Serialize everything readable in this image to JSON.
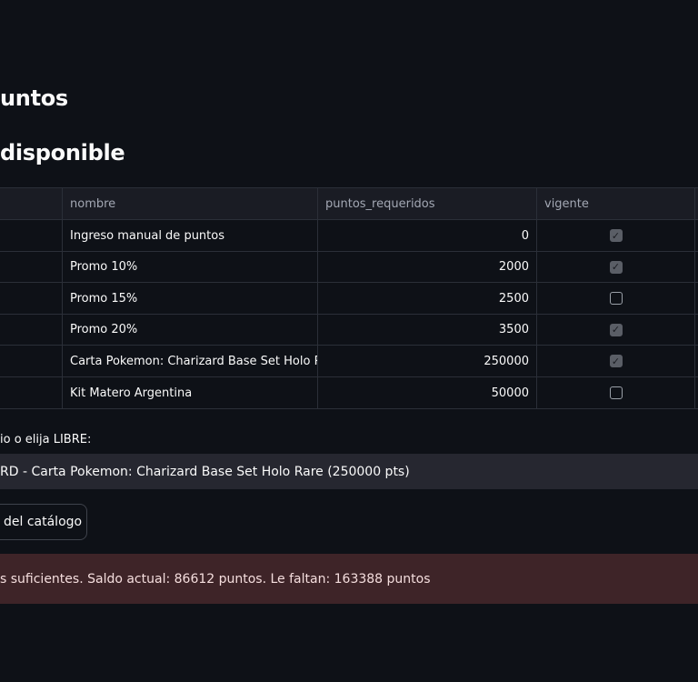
{
  "page": {
    "heading_partial": "untos",
    "subheading_partial": "disponible"
  },
  "table": {
    "columns": [
      "",
      "nombre",
      "puntos_requeridos",
      "vigente"
    ],
    "rows": [
      {
        "nombre": "Ingreso manual de puntos",
        "puntos_requeridos": "0",
        "vigente": true
      },
      {
        "nombre": "Promo 10%",
        "puntos_requeridos": "2000",
        "vigente": true
      },
      {
        "nombre": "Promo 15%",
        "puntos_requeridos": "2500",
        "vigente": false
      },
      {
        "nombre": "Promo 20%",
        "puntos_requeridos": "3500",
        "vigente": true
      },
      {
        "nombre": "Carta Pokemon: Charizard Base Set Holo Rare",
        "puntos_requeridos": "250000",
        "vigente": true
      },
      {
        "nombre": "Kit Matero Argentina",
        "puntos_requeridos": "50000",
        "vigente": false
      }
    ]
  },
  "select": {
    "label_partial": "io o elija LIBRE:",
    "selected_partial": "RD - Carta Pokemon: Charizard Base Set Holo Rare (250000 pts)"
  },
  "button": {
    "label_partial": "del catálogo"
  },
  "alert": {
    "message_partial": "s suficientes. Saldo actual: 86612 puntos. Le faltan: 163388 puntos"
  },
  "icons": {
    "check": "check-icon"
  },
  "colors": {
    "background": "#0e1117",
    "table_header": "#1a1c24",
    "select_bg": "#262730",
    "alert_bg": "#3e2428",
    "checkbox_checked": "#5a5e66"
  }
}
